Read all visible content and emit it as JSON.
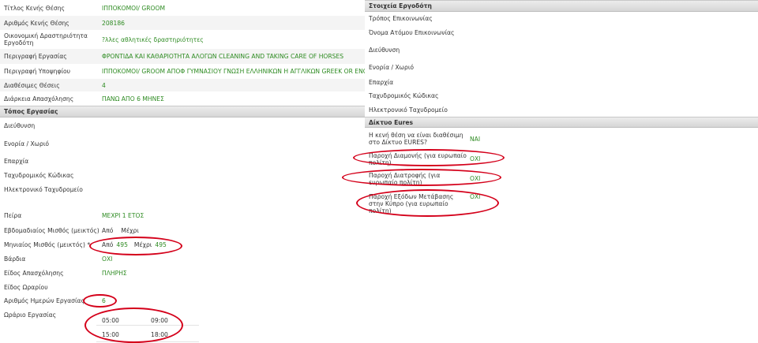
{
  "job": {
    "rows": [
      {
        "label": "Τίτλος Κενής Θέσης",
        "value": "ΙΠΠΟΚΟΜΟΙ/ GROOM"
      },
      {
        "label": "Αριθμός Κενής Θέσης",
        "value": "208186"
      },
      {
        "label": "Οικονομική Δραστηριότητα Εργοδότη",
        "value": "?λλες αθλητικές δραστηριότητες"
      },
      {
        "label": "Περιγραφή Εργασίας",
        "value": "ΦΡΟΝΤΙΔΑ ΚΑΙ ΚΑΘΑΡΙΟΤΗΤΑ ΑΛΟΓΩΝ CLEANING AND TAKING CARE OF HORSES"
      },
      {
        "label": "Περιγραφή Υποψηφίου",
        "value": "ΙΠΠΟΚΟΜΟΙ/ GROOM ΑΠΟΦ ΓΥΜΝΑΣΙΟΥ ΓΝΩΣΗ ΕΛΛΗΝΙΚΩΝ Η ΑΓΓΛΙΚΩΝ GREEK OR ENGLISH"
      },
      {
        "label": "Διαθέσιμες Θέσεις",
        "value": "4"
      },
      {
        "label": "Διάρκεια Απασχόλησης",
        "value": "ΠΑΝΩ ΑΠΟ 6 ΜΗΝΕΣ"
      }
    ]
  },
  "workplace": {
    "header": "Τόπος Εργασίας",
    "rows": [
      {
        "label": "Διεύθυνση",
        "value": ""
      },
      {
        "label": "Ενορία / Χωριό",
        "value": ""
      },
      {
        "label": "Επαρχία",
        "value": ""
      },
      {
        "label": "Ταχυδρομικός Κώδικας",
        "value": ""
      },
      {
        "label": "Ηλεκτρονικό Ταχυδρομείο",
        "value": ""
      }
    ]
  },
  "terms": {
    "experience_label": "Πείρα",
    "experience_value": "ΜΕΧΡΙ 1 ΕΤΟΣ",
    "weekly_salary_label": "Εβδομαδιαίος Μισθός (μεικτός)",
    "from_label": "Από",
    "to_label": "Μέχρι",
    "monthly_salary_label": "Μηνιαίος Μισθός (μεικτός) *",
    "monthly_from": "495",
    "monthly_to": "495",
    "shift_label": "Βάρδια",
    "shift_value": "ΟΧΙ",
    "employment_type_label": "Είδος Απασχόλησης",
    "employment_type_value": "ΠΛΗΡΗΣ",
    "schedule_type_label": "Είδος Ωραρίου",
    "workdays_label": "Αριθμός Ημερών Εργασίας",
    "workdays_value": "6",
    "hours_label": "Ωράριο Εργασίας",
    "hours": [
      {
        "start": "05:00",
        "end": "09:00"
      },
      {
        "start": "15:00",
        "end": "18:00"
      }
    ]
  },
  "employer": {
    "header": "Στοιχεία Εργοδότη",
    "rows": [
      {
        "label": "Τρόπος Επικοινωνίας",
        "value": ""
      },
      {
        "label": "Όνομα Ατόμου Επικοινωνίας",
        "value": ""
      },
      {
        "label": "Διεύθυνση",
        "value": ""
      },
      {
        "label": "Ενορία / Χωριό",
        "value": ""
      },
      {
        "label": "Επαρχία",
        "value": ""
      },
      {
        "label": "Ταχυδρομικός Κώδικας",
        "value": ""
      },
      {
        "label": "Ηλεκτρονικό Ταχυδρομείο",
        "value": ""
      }
    ]
  },
  "eures": {
    "header": "Δίκτυο Eures",
    "rows": [
      {
        "label": "Η κενή θέση να είναι διαθέσιμη στο Δίκτυο EURES?",
        "value": "ΝΑΙ"
      },
      {
        "label": "Παροχή Διαμονής (για ευρωπαίο πολίτη)",
        "value": "ΟΧΙ"
      },
      {
        "label": "Παροχή Διατροφής (για ευρωπαίο πολίτη)",
        "value": "ΟΧΙ"
      },
      {
        "label": "Παροχή Εξόδων Μετάβασης στην Κύπρο (για ευρωπαίο πολίτη)",
        "value": "ΟΧΙ"
      }
    ]
  },
  "colors": {
    "value_text": "#2e8b22",
    "annotation": "#d4001a"
  }
}
